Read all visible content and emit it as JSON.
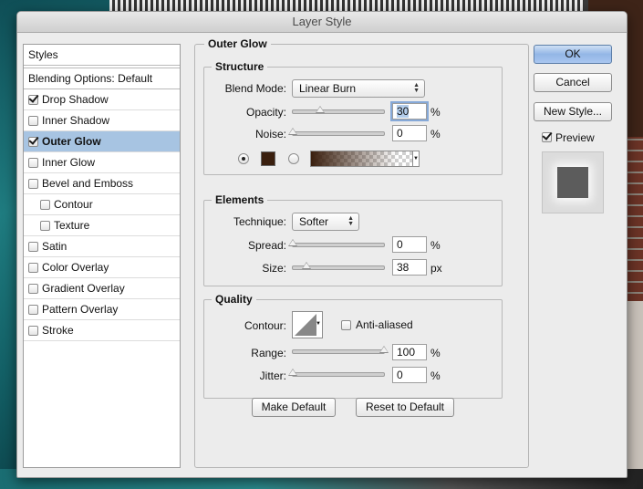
{
  "window": {
    "title": "Layer Style"
  },
  "sidebar": {
    "header": "Styles",
    "blending_options": "Blending Options: Default",
    "items": [
      {
        "label": "Drop Shadow",
        "checked": true,
        "indent": false,
        "selected": false
      },
      {
        "label": "Inner Shadow",
        "checked": false,
        "indent": false,
        "selected": false
      },
      {
        "label": "Outer Glow",
        "checked": true,
        "indent": false,
        "selected": true
      },
      {
        "label": "Inner Glow",
        "checked": false,
        "indent": false,
        "selected": false
      },
      {
        "label": "Bevel and Emboss",
        "checked": false,
        "indent": false,
        "selected": false
      },
      {
        "label": "Contour",
        "checked": false,
        "indent": true,
        "selected": false
      },
      {
        "label": "Texture",
        "checked": false,
        "indent": true,
        "selected": false
      },
      {
        "label": "Satin",
        "checked": false,
        "indent": false,
        "selected": false
      },
      {
        "label": "Color Overlay",
        "checked": false,
        "indent": false,
        "selected": false
      },
      {
        "label": "Gradient Overlay",
        "checked": false,
        "indent": false,
        "selected": false
      },
      {
        "label": "Pattern Overlay",
        "checked": false,
        "indent": false,
        "selected": false
      },
      {
        "label": "Stroke",
        "checked": false,
        "indent": false,
        "selected": false
      }
    ]
  },
  "panel": {
    "title": "Outer Glow",
    "structure": {
      "title": "Structure",
      "blend_mode_label": "Blend Mode:",
      "blend_mode_value": "Linear Burn",
      "opacity_label": "Opacity:",
      "opacity_value": "30",
      "opacity_unit": "%",
      "opacity_level": 0.3,
      "noise_label": "Noise:",
      "noise_value": "0",
      "noise_unit": "%",
      "noise_level": 0,
      "glow_color": "#3a1f0e",
      "color_mode": "solid"
    },
    "elements": {
      "title": "Elements",
      "technique_label": "Technique:",
      "technique_value": "Softer",
      "spread_label": "Spread:",
      "spread_value": "0",
      "spread_unit": "%",
      "spread_level": 0,
      "size_label": "Size:",
      "size_value": "38",
      "size_unit": "px",
      "size_level": 0.15
    },
    "quality": {
      "title": "Quality",
      "contour_label": "Contour:",
      "anti_aliased_label": "Anti-aliased",
      "anti_aliased": false,
      "range_label": "Range:",
      "range_value": "100",
      "range_unit": "%",
      "range_level": 1.0,
      "jitter_label": "Jitter:",
      "jitter_value": "0",
      "jitter_unit": "%",
      "jitter_level": 0
    },
    "make_default": "Make Default",
    "reset_default": "Reset to Default"
  },
  "actions": {
    "ok": "OK",
    "cancel": "Cancel",
    "new_style": "New Style...",
    "preview_label": "Preview",
    "preview_checked": true
  }
}
